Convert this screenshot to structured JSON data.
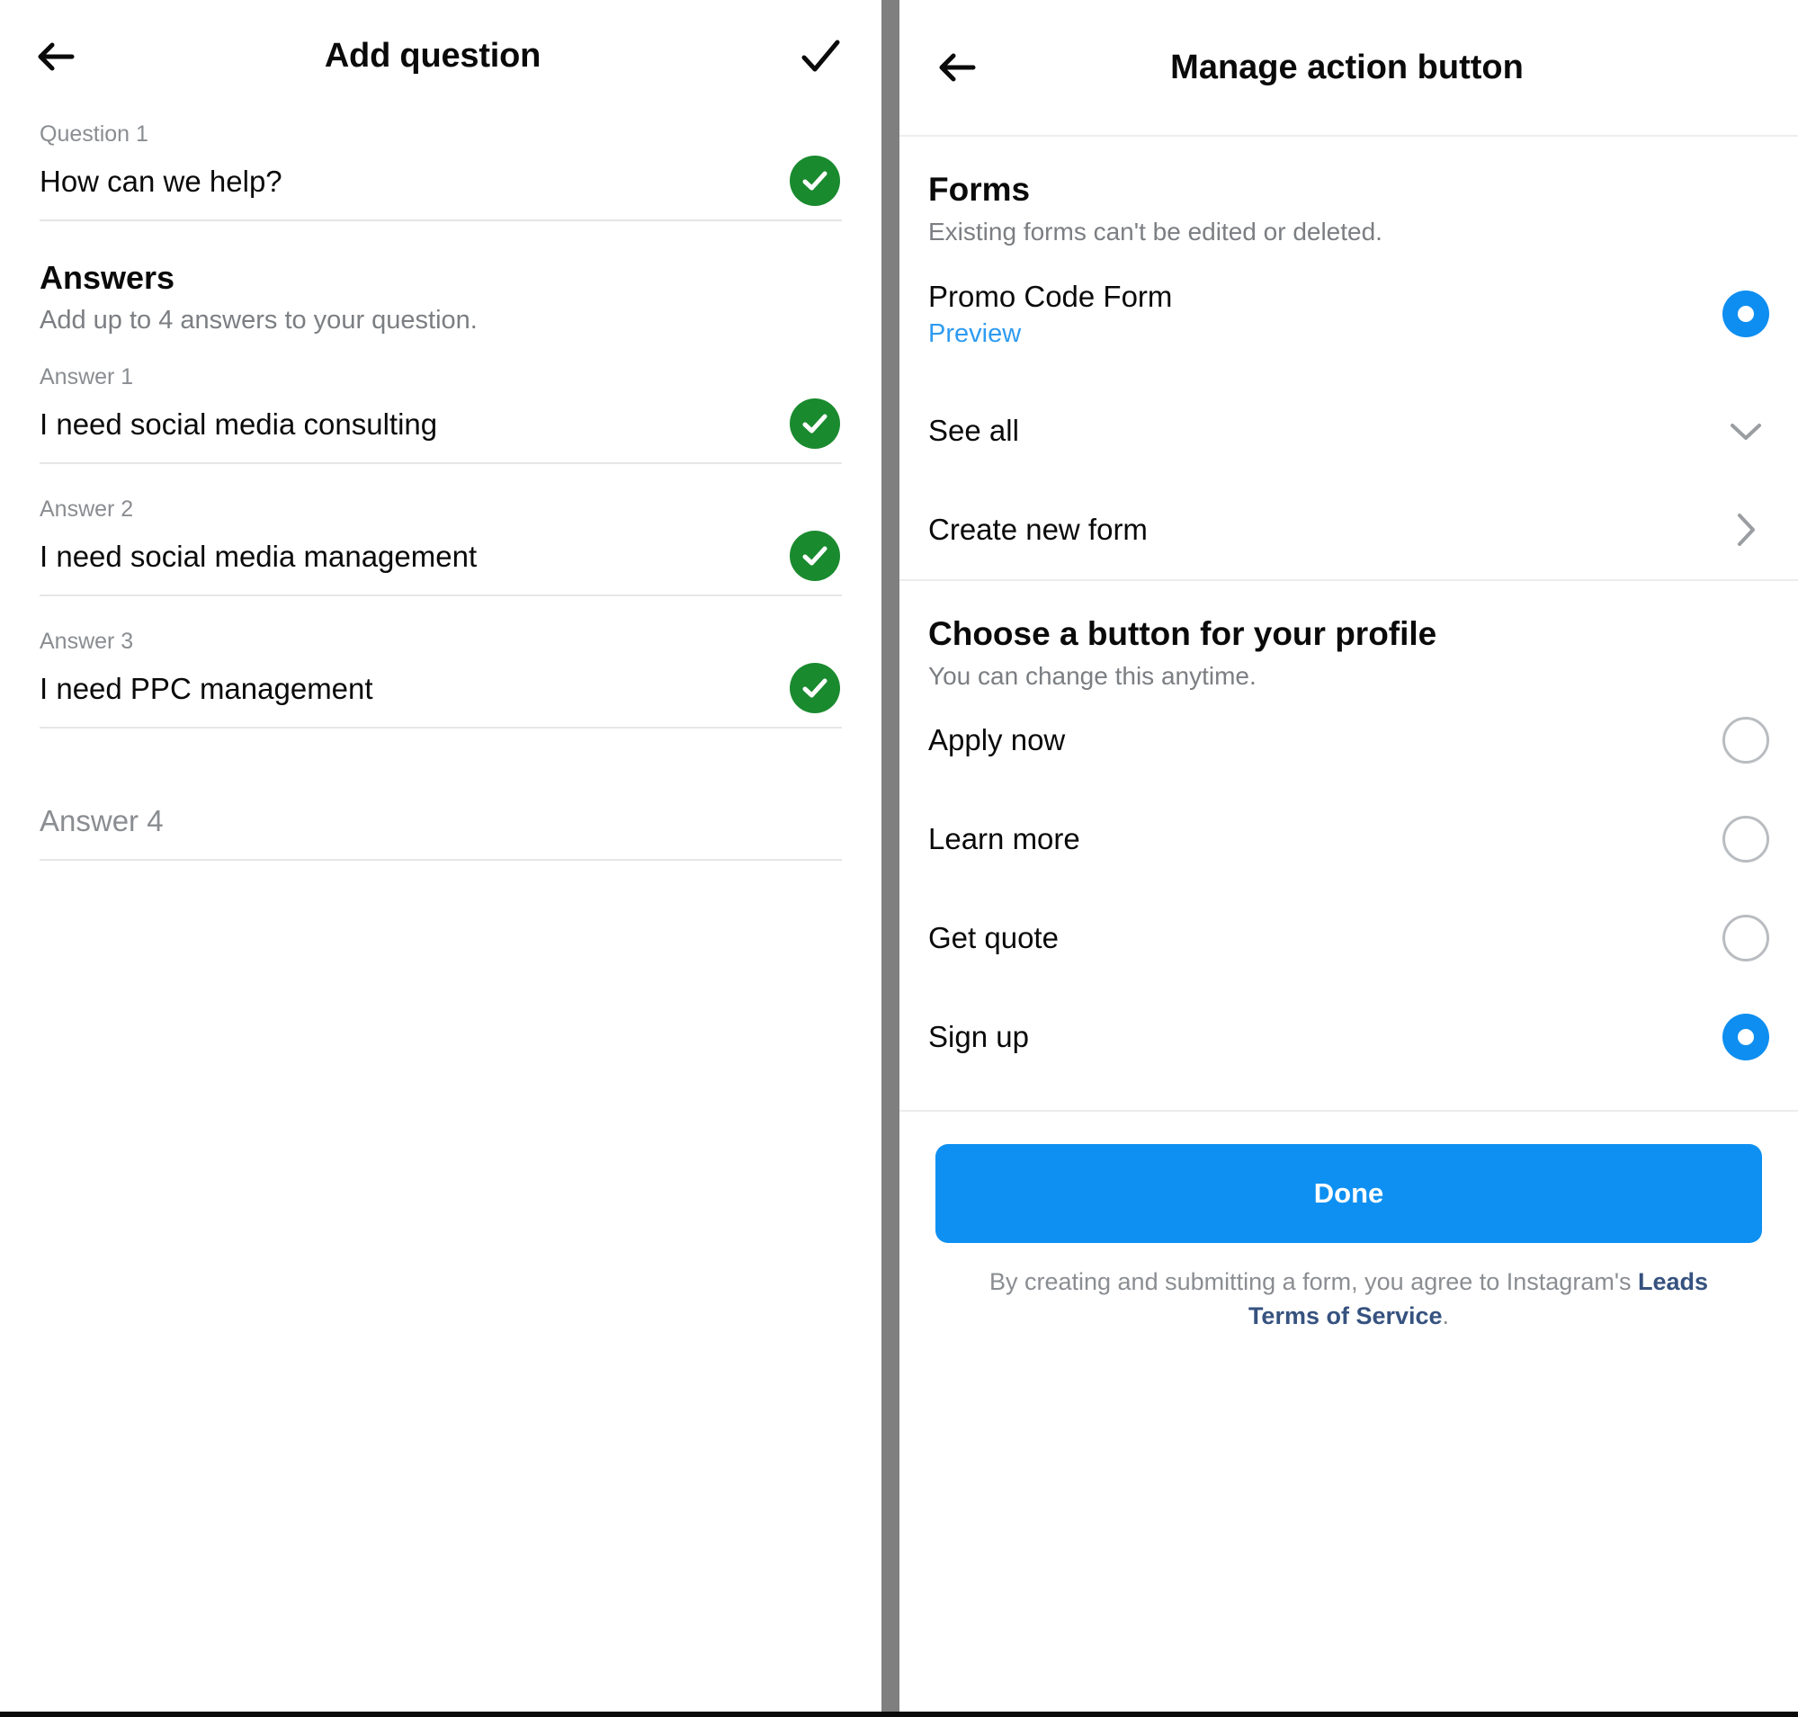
{
  "left_panel": {
    "header": {
      "back_icon": "arrow-left-icon",
      "title": "Add question",
      "confirm_icon": "checkmark-icon"
    },
    "question": {
      "label": "Question 1",
      "value": "How can we help?",
      "status_icon": "green-check-circle-icon"
    },
    "answers_section": {
      "title": "Answers",
      "subtitle": "Add up to 4 answers to your question.",
      "items": [
        {
          "label": "Answer 1",
          "value": "I need social media consulting",
          "filled": true,
          "status_icon": "green-check-circle-icon"
        },
        {
          "label": "Answer 2",
          "value": "I need social media management",
          "filled": true,
          "status_icon": "green-check-circle-icon"
        },
        {
          "label": "Answer 3",
          "value": "I need PPC management",
          "filled": true,
          "status_icon": "green-check-circle-icon"
        },
        {
          "label": "",
          "value": "Answer 4",
          "filled": false,
          "status_icon": ""
        }
      ]
    }
  },
  "right_panel": {
    "header": {
      "back_icon": "arrow-left-icon",
      "title": "Manage action button"
    },
    "forms_section": {
      "title": "Forms",
      "subtitle": "Existing forms can't be edited or deleted.",
      "form_item": {
        "name": "Promo Code Form",
        "preview_link": "Preview",
        "selected": true
      },
      "see_all": {
        "label": "See all",
        "icon": "chevron-down-icon"
      },
      "create_new": {
        "label": "Create new form",
        "icon": "chevron-right-icon"
      }
    },
    "button_section": {
      "title": "Choose a button for your profile",
      "subtitle": "You can change this anytime.",
      "options": [
        {
          "label": "Apply now",
          "selected": false
        },
        {
          "label": "Learn more",
          "selected": false
        },
        {
          "label": "Get quote",
          "selected": false
        },
        {
          "label": "Sign up",
          "selected": true
        }
      ]
    },
    "footer": {
      "done_label": "Done",
      "tos_prefix": "By creating and submitting a form, you agree to Instagram's ",
      "tos_link": "Leads Terms of Service",
      "tos_suffix": "."
    }
  },
  "colors": {
    "accent_blue": "#0e90f2",
    "link_blue": "#2e9bf0",
    "success_green": "#1a8a2f",
    "tos_link": "#36527f",
    "gutter_gray": "#7f7f7f",
    "muted_text": "#8a8d91"
  }
}
